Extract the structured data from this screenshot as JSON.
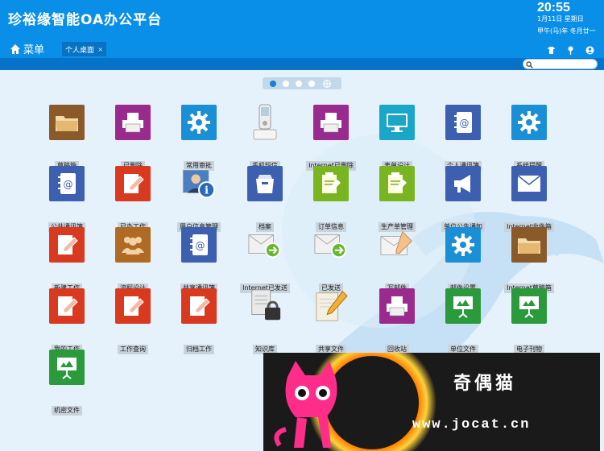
{
  "header": {
    "title": "珍裕缘智能OA办公平台",
    "clock": "20:55",
    "date_line1": "1月11日 星期日",
    "date_line2": "甲午(马)年 冬月廿一",
    "menu_label": "菜单",
    "tab_label": "个人桌面",
    "tab_close": "×"
  },
  "top_icons": [
    "shirt-icon",
    "pin-icon",
    "user-icon"
  ],
  "pager": {
    "pages": 4,
    "active": 1
  },
  "apps": [
    {
      "label": "草稿箱",
      "icon": "folder-icon",
      "color": "#8b5a2b"
    },
    {
      "label": "已删除",
      "icon": "printer-icon",
      "color": "#9b2a8f"
    },
    {
      "label": "常用审批",
      "icon": "gear-icon",
      "color": "#1a8fd6"
    },
    {
      "label": "手机短信",
      "icon": "phone-icon",
      "color": ""
    },
    {
      "label": "Internet已删除",
      "icon": "printer-icon",
      "color": "#9b2a8f"
    },
    {
      "label": "表单设计",
      "icon": "monitor-icon",
      "color": "#19a6c9"
    },
    {
      "label": "个人通讯簿",
      "icon": "addressbook-icon",
      "color": "#3d5fb0"
    },
    {
      "label": "系统提醒",
      "icon": "gear-icon",
      "color": "#1a8fd6"
    },
    {
      "label": "公共通讯簿",
      "icon": "addressbook-icon",
      "color": "#3d5fb0"
    },
    {
      "label": "已办工作",
      "icon": "edit-icon",
      "color": "#d93a1f"
    },
    {
      "label": "用户信息管理",
      "icon": "user-info-icon",
      "color": ""
    },
    {
      "label": "档案",
      "icon": "archive-box-icon",
      "color": "#3d5fb0"
    },
    {
      "label": "订单信息",
      "icon": "note-edit-icon",
      "color": "#78b520"
    },
    {
      "label": "生产单管理",
      "icon": "note-edit-icon",
      "color": "#78b520"
    },
    {
      "label": "单位公告通知",
      "icon": "megaphone-icon",
      "color": "#3d5fb0"
    },
    {
      "label": "Internet收件箱",
      "icon": "mail-icon",
      "color": "#3d5fb0"
    },
    {
      "label": "新建工作",
      "icon": "edit-icon",
      "color": "#d93a1f"
    },
    {
      "label": "流程设计",
      "icon": "group-icon",
      "color": "#b06a23"
    },
    {
      "label": "共享通讯簿",
      "icon": "addressbook-icon",
      "color": "#3d5fb0"
    },
    {
      "label": "Internet已发送",
      "icon": "mail-send-icon",
      "color": ""
    },
    {
      "label": "已发送",
      "icon": "mail-send-icon",
      "color": ""
    },
    {
      "label": "写邮件",
      "icon": "mail-write-icon",
      "color": ""
    },
    {
      "label": "邮件设置",
      "icon": "gear-icon",
      "color": "#1a8fd6"
    },
    {
      "label": "Internet草稿箱",
      "icon": "folder-icon",
      "color": "#8b5a2b"
    },
    {
      "label": "我的工作",
      "icon": "edit-icon",
      "color": "#d93a1f"
    },
    {
      "label": "工作查询",
      "icon": "edit-icon",
      "color": "#d93a1f"
    },
    {
      "label": "归档工作",
      "icon": "edit-icon",
      "color": "#d93a1f"
    },
    {
      "label": "知识库",
      "icon": "lock-doc-icon",
      "color": ""
    },
    {
      "label": "共享文件",
      "icon": "pencil-doc-icon",
      "color": ""
    },
    {
      "label": "回收站",
      "icon": "printer-icon",
      "color": "#9b2a8f"
    },
    {
      "label": "单位文件",
      "icon": "presentation-icon",
      "color": "#2b9a3c"
    },
    {
      "label": "电子刊物",
      "icon": "presentation-icon",
      "color": "#2b9a3c"
    },
    {
      "label": "机密文件",
      "icon": "presentation-icon",
      "color": "#2b9a3c"
    }
  ],
  "watermark": {
    "title": "奇偶猫",
    "url": "www.jocat.cn"
  }
}
